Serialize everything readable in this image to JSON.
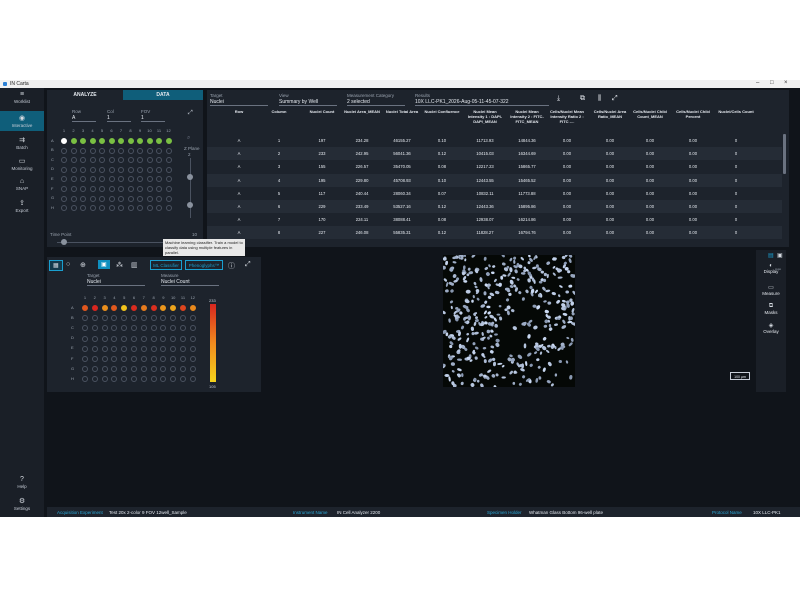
{
  "window": {
    "title": "IN Carta"
  },
  "nav": {
    "items": [
      {
        "label": "Worklist",
        "icon": "menu-icon"
      },
      {
        "label": "Interactive",
        "icon": "eye-icon"
      },
      {
        "label": "Batch",
        "icon": "batch-icon"
      },
      {
        "label": "Monitoring",
        "icon": "monitor-icon"
      },
      {
        "label": "SNAP",
        "icon": "snap-icon"
      },
      {
        "label": "Export",
        "icon": "export-icon"
      },
      {
        "label": "Help",
        "icon": "help-icon"
      },
      {
        "label": "Settings",
        "icon": "gear-icon"
      }
    ]
  },
  "plate_panel": {
    "tab_analyze": "ANALYZE",
    "tab_data": "DATA",
    "row_label": "Row",
    "row_value": "A",
    "col_label": "Col",
    "col_value": "1",
    "fov_label": "FOV",
    "fov_value": "1",
    "columns": [
      "1",
      "2",
      "3",
      "4",
      "5",
      "6",
      "7",
      "8",
      "9",
      "10",
      "11",
      "12"
    ],
    "rows": [
      "A",
      "B",
      "C",
      "D",
      "E",
      "F",
      "G",
      "H"
    ],
    "zplane_label": "Z Plane",
    "zplane_value": "2",
    "timepoint_label": "Time Point",
    "timepoint_value": "10"
  },
  "table_panel": {
    "target_label": "Target",
    "target_value": "Nuclei",
    "view_label": "View",
    "view_value": "Summary by Well",
    "category_label": "Measurement Category",
    "category_value": "2 selected",
    "results_label": "Results",
    "results_value": "10X LLC-PK1_2026-Aug-05-11-45-07-322",
    "headers": [
      "Row",
      "Column",
      "Nuclei Count",
      "Nuclei Area_MEAN",
      "Nuclei Total Area",
      "Nuclei Confluence",
      "Nuclei Mean Intensity 1 : DAPI-DAPI_MEAN",
      "Nuclei Mean Intensity 2 : FITC-FITC_MEAN",
      "Cells/Nuclei Mean Intensity Ratio 2 : FITC -...",
      "Cells/Nuclei Area Ratio_MEAN",
      "Cells/Nuclei Child Count_MEAN",
      "Cells/Nuclei Child Percent",
      "Nuclei/Cells Count"
    ],
    "rows": [
      [
        "A",
        "1",
        "197",
        "234.28",
        "46155.27",
        "0.10",
        "11713.93",
        "14844.36",
        "0.00",
        "0.00",
        "0.00",
        "0.00",
        "0"
      ],
      [
        "A",
        "2",
        "233",
        "242.95",
        "56041.36",
        "0.12",
        "10415.03",
        "16344.69",
        "0.00",
        "0.00",
        "0.00",
        "0.00",
        "0"
      ],
      [
        "A",
        "3",
        "155",
        "226.57",
        "35470.05",
        "0.08",
        "12217.23",
        "15865.77",
        "0.00",
        "0.00",
        "0.00",
        "0.00",
        "0"
      ],
      [
        "A",
        "4",
        "195",
        "229.80",
        "45708.93",
        "0.10",
        "12443.55",
        "15465.52",
        "0.00",
        "0.00",
        "0.00",
        "0.00",
        "0"
      ],
      [
        "A",
        "5",
        "117",
        "240.44",
        "28060.34",
        "0.07",
        "10832.11",
        "11773.88",
        "0.00",
        "0.00",
        "0.00",
        "0.00",
        "0"
      ],
      [
        "A",
        "6",
        "229",
        "233.49",
        "53527.16",
        "0.12",
        "12443.36",
        "15895.86",
        "0.00",
        "0.00",
        "0.00",
        "0.00",
        "0"
      ],
      [
        "A",
        "7",
        "170",
        "224.11",
        "38088.41",
        "0.08",
        "12938.07",
        "16214.86",
        "0.00",
        "0.00",
        "0.00",
        "0.00",
        "0"
      ],
      [
        "A",
        "8",
        "227",
        "246.08",
        "55835.31",
        "0.12",
        "11828.27",
        "16794.76",
        "0.00",
        "0.00",
        "0.00",
        "0.00",
        "0"
      ]
    ]
  },
  "heatmap_panel": {
    "btn_classifier": "ML Classifier",
    "btn_phenoglyphs": "Phenoglyphs™",
    "target_label": "Target",
    "target_value": "Nuclei",
    "measure_label": "Measure",
    "measure_value": "Nuclei Count",
    "columns": [
      "1",
      "2",
      "3",
      "4",
      "5",
      "6",
      "7",
      "8",
      "9",
      "10",
      "11",
      "12"
    ],
    "rows": [
      "A",
      "B",
      "C",
      "D",
      "E",
      "F",
      "G",
      "H"
    ],
    "row_a_values": [
      197,
      233,
      155,
      195,
      117,
      229,
      170,
      227,
      150,
      140,
      210,
      160
    ],
    "scale_max": "233",
    "scale_min": "105",
    "tooltip": "Machine learning classifier. Train a model to classify data using multiple features in parallel."
  },
  "image_panel": {
    "scale_bar": "100 µm"
  },
  "right_tools": {
    "items": [
      "Display",
      "Measure",
      "Masks",
      "Overlay"
    ],
    "auto_label": "Auto"
  },
  "footer": {
    "acq_label": "Acquisition Experiment",
    "acq_value": "Test 20x 2-color 9 FOV 12well_Sample",
    "instr_label": "Instrument Name",
    "instr_value": "IN Cell Analyzer 2200",
    "spec_label": "Specimen Holder",
    "spec_value": "Whatman Glass Bottom 96-well plate",
    "proto_label": "Protocol Name",
    "proto_value": "10X LLC-PK1"
  },
  "colors": {
    "accent": "#1a9fd0",
    "well_green": "#7ac043",
    "heat_low": "#f5d31c",
    "heat_high": "#d8261f"
  }
}
